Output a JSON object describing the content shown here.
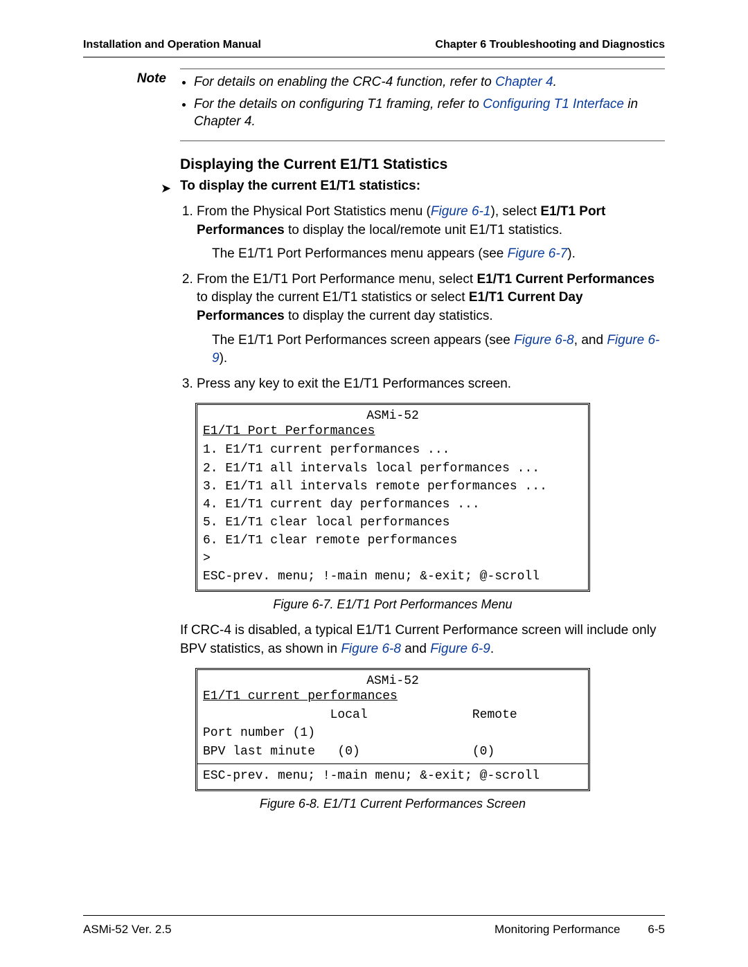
{
  "header": {
    "left": "Installation and Operation Manual",
    "right": "Chapter 6  Troubleshooting and Diagnostics"
  },
  "note_label": "Note",
  "notes": {
    "n1_pre": "For details on enabling the CRC-4 function, refer to ",
    "n1_link": "Chapter 4",
    "n1_post": ".",
    "n2_pre": "For the details on configuring T1 framing, refer to ",
    "n2_link": "Configuring T1 Interface",
    "n2_mid": " in Chapter 4."
  },
  "section_title": "Displaying the Current E1/T1 Statistics",
  "proc_title": "To display the current E1/T1 statistics:",
  "steps": {
    "s1_a": "From the Physical Port Statistics menu (",
    "s1_link": "Figure 6-1",
    "s1_b": "), select ",
    "s1_bold": "E1/T1 Port Performances",
    "s1_c": " to display the local/remote unit E1/T1 statistics.",
    "s1_sub_a": "The E1/T1 Port Performances menu appears (see ",
    "s1_sub_link": "Figure 6-7",
    "s1_sub_b": ").",
    "s2_a": "From the E1/T1 Port Performance menu, select ",
    "s2_bold1": "E1/T1 Current Performances",
    "s2_b": " to display the current E1/T1 statistics or select ",
    "s2_bold2": "E1/T1 Current Day Performances",
    "s2_c": " to display the current day statistics.",
    "s2_sub_a": "The E1/T1 Port Performances screen appears (see ",
    "s2_sub_link1": "Figure 6-8",
    "s2_sub_mid": ", and ",
    "s2_sub_link2": "Figure 6-9",
    "s2_sub_b": ").",
    "s3": "Press any key to exit the E1/T1 Performances screen."
  },
  "figure7": {
    "title": "ASMi-52",
    "heading": "E1/T1 Port Performances",
    "lines": "1. E1/T1 current performances ...\n2. E1/T1 all intervals local performances ...\n3. E1/T1 all intervals remote performances ...\n4. E1/T1 current day performances ...\n5. E1/T1 clear local performances\n6. E1/T1 clear remote performances\n>\nESC-prev. menu; !-main menu; &-exit; @-scroll",
    "caption": "Figure 6-7.  E1/T1 Port Performances Menu"
  },
  "mid_para": {
    "a": "If CRC-4 is disabled, a typical E1/T1 Current Performance screen will include only BPV statistics, as shown in ",
    "link1": "Figure 6-8",
    "mid": " and ",
    "link2": "Figure 6-9",
    "b": "."
  },
  "figure8": {
    "title": "ASMi-52",
    "heading": "E1/T1 current performances",
    "body": "                 Local              Remote\nPort number (1)\nBPV last minute   (0)               (0)",
    "footer": "ESC-prev. menu; !-main menu; &-exit; @-scroll",
    "caption": "Figure 6-8.  E1/T1 Current Performances Screen"
  },
  "footer": {
    "left": "ASMi-52 Ver. 2.5",
    "mid": "Monitoring Performance",
    "right": "6-5"
  }
}
